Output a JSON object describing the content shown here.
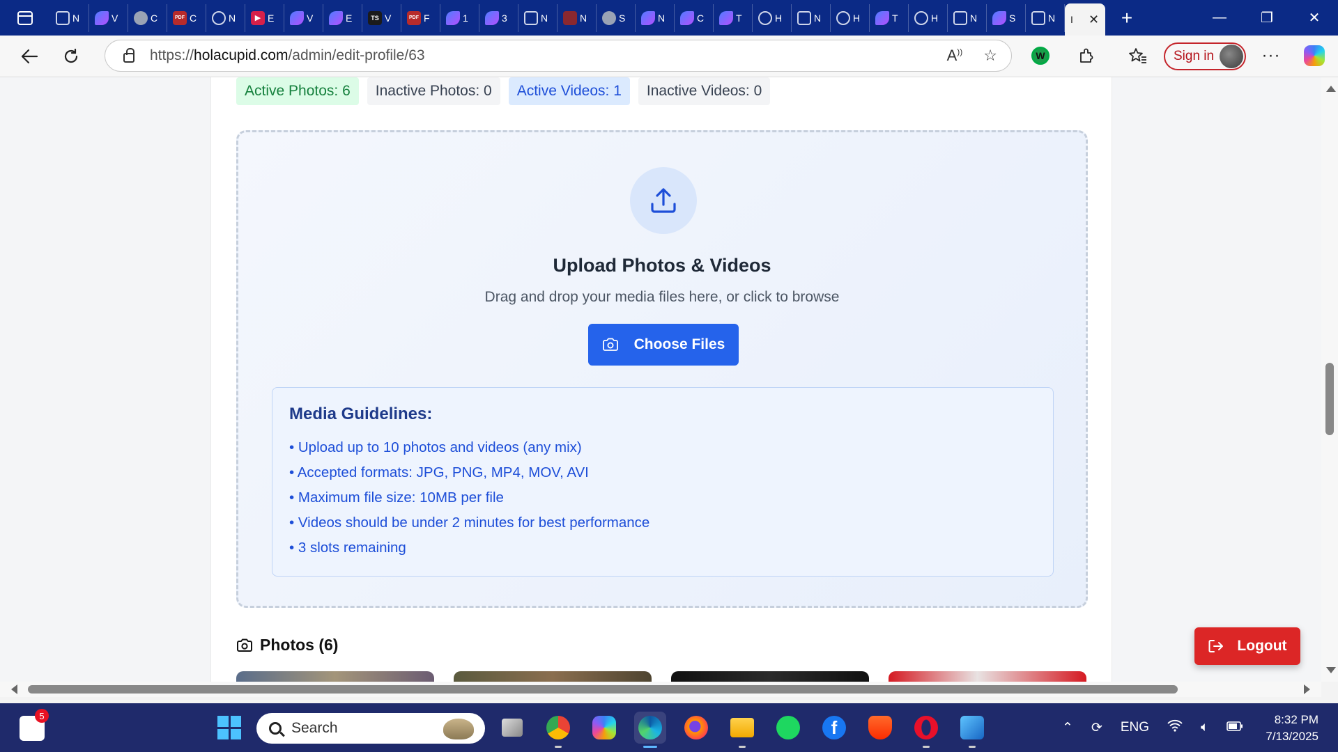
{
  "browser": {
    "tabs": [
      {
        "icon": "page-icon",
        "title": "N"
      },
      {
        "icon": "gemini-icon",
        "title": "V"
      },
      {
        "icon": "round-icon",
        "title": "C"
      },
      {
        "icon": "pdf-icon",
        "title": "C"
      },
      {
        "icon": "globe-icon",
        "title": "N"
      },
      {
        "icon": "youtube-icon",
        "title": "E"
      },
      {
        "icon": "gemini-icon",
        "title": "V"
      },
      {
        "icon": "gemini-icon",
        "title": "E"
      },
      {
        "icon": "ts-icon",
        "title": "V"
      },
      {
        "icon": "pdf-icon",
        "title": "F"
      },
      {
        "icon": "gemini-icon",
        "title": "1"
      },
      {
        "icon": "gemini-icon",
        "title": "3"
      },
      {
        "icon": "page-icon",
        "title": "N"
      },
      {
        "icon": "chart-icon",
        "title": "N"
      },
      {
        "icon": "round-icon",
        "title": "S"
      },
      {
        "icon": "gemini-icon",
        "title": "N"
      },
      {
        "icon": "gemini-icon",
        "title": "C"
      },
      {
        "icon": "gemini-icon",
        "title": "T"
      },
      {
        "icon": "globe-icon",
        "title": "H"
      },
      {
        "icon": "page-icon",
        "title": "N"
      },
      {
        "icon": "globe-icon",
        "title": "H"
      },
      {
        "icon": "gemini-icon",
        "title": "T"
      },
      {
        "icon": "globe-icon",
        "title": "H"
      },
      {
        "icon": "page-icon",
        "title": "N"
      },
      {
        "icon": "gemini-icon",
        "title": "S"
      },
      {
        "icon": "page-icon",
        "title": "N"
      }
    ],
    "active_tab_title": "I",
    "url_prefix": "https://",
    "url_host": "holacupid.com",
    "url_path": "/admin/edit-profile/63",
    "sign_in_label": "Sign in",
    "more_label": "···"
  },
  "page": {
    "stats": {
      "active_photos": "Active Photos: 6",
      "inactive_photos": "Inactive Photos: 0",
      "active_videos": "Active Videos: 1",
      "inactive_videos": "Inactive Videos: 0"
    },
    "upload": {
      "title": "Upload Photos & Videos",
      "subtitle": "Drag and drop your media files here, or click to browse",
      "button_label": "Choose Files"
    },
    "guidelines": {
      "heading": "Media Guidelines:",
      "items": [
        "• Upload up to 10 photos and videos (any mix)",
        "• Accepted formats: JPG, PNG, MP4, MOV, AVI",
        "• Maximum file size: 10MB per file",
        "• Videos should be under 2 minutes for best performance",
        "• 3 slots remaining"
      ]
    },
    "photos_heading": "Photos (6)",
    "logout_label": "Logout"
  },
  "taskbar": {
    "notification_count": "5",
    "search_placeholder": "Search",
    "apps": [
      "task-view-icon",
      "chrome-icon",
      "copilot-icon",
      "edge-icon",
      "firefox-icon",
      "file-explorer-icon",
      "spotify-icon",
      "facebook-icon",
      "brave-icon",
      "opera-icon",
      "photos-icon"
    ],
    "language": "ENG",
    "time": "8:32 PM",
    "date": "7/13/2025"
  },
  "colors": {
    "primary": "#2563eb",
    "danger": "#dc2626",
    "tabstrip": "#0b2a86",
    "taskbar": "#1f2a6b"
  }
}
